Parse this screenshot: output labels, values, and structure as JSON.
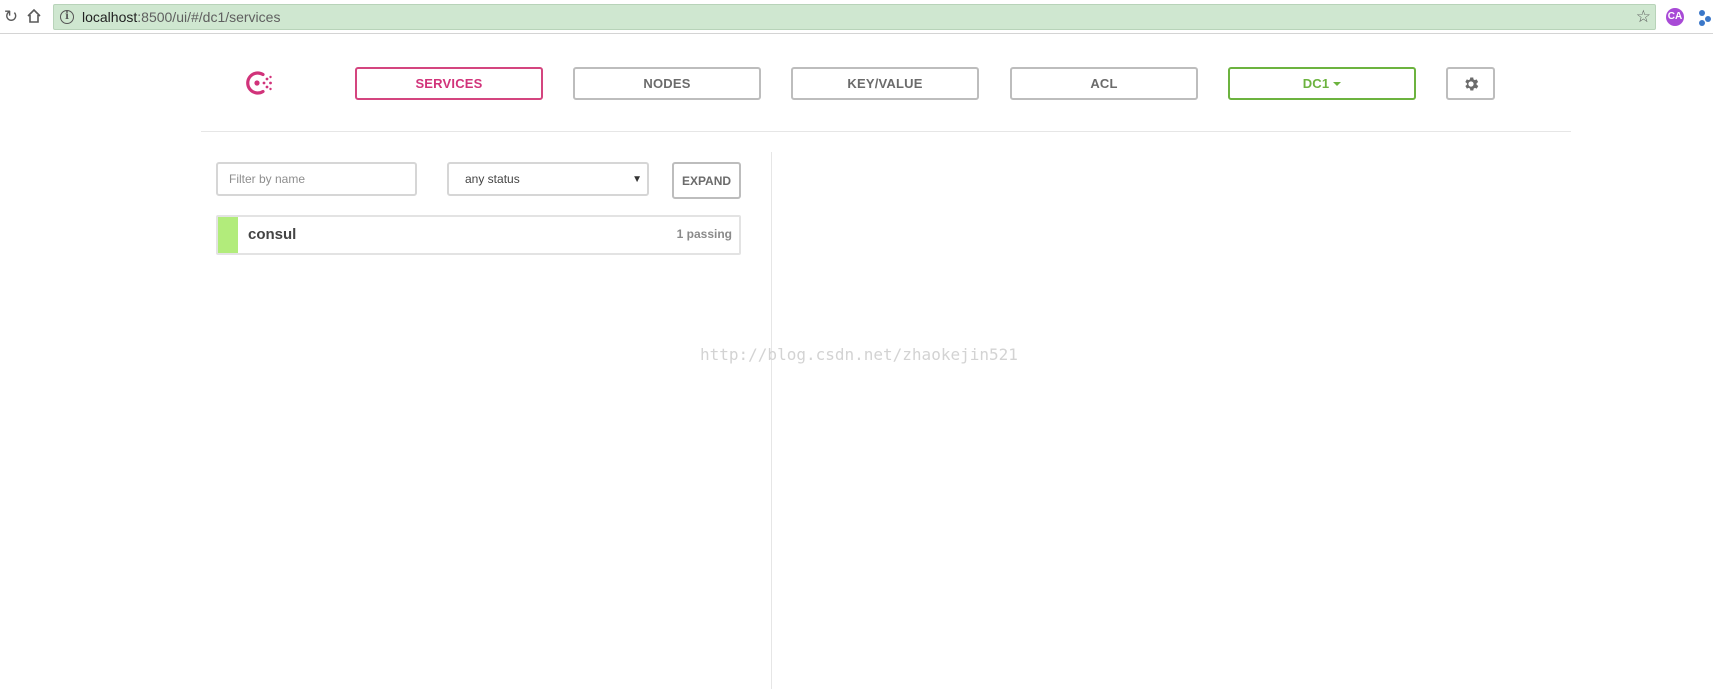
{
  "browser": {
    "url_host": "localhost",
    "url_rest": ":8500/ui/#/dc1/services",
    "ext_icon_1_label": "CA"
  },
  "icons": {
    "reload": "reload-icon",
    "home": "home-icon",
    "info": "info-icon",
    "star": "star-icon",
    "settings": "gear-icon",
    "logo": "consul-logo-icon"
  },
  "nav": {
    "tabs": [
      {
        "label": "SERVICES",
        "active": true
      },
      {
        "label": "NODES"
      },
      {
        "label": "KEY/VALUE"
      },
      {
        "label": "ACL"
      }
    ],
    "datacenter": "DC1"
  },
  "filters": {
    "name_placeholder": "Filter by name",
    "status_selected": "any status",
    "expand_label": "EXPAND"
  },
  "services": [
    {
      "name": "consul",
      "checks": "1 passing",
      "status_color": "#b2ec7b"
    }
  ],
  "watermark": "http://blog.csdn.net/zhaokejin521",
  "colors": {
    "accent_pink": "#d1337a",
    "accent_green": "#6cb33f",
    "passing": "#b2ec7b",
    "omnibox": "#cfe7d0"
  }
}
